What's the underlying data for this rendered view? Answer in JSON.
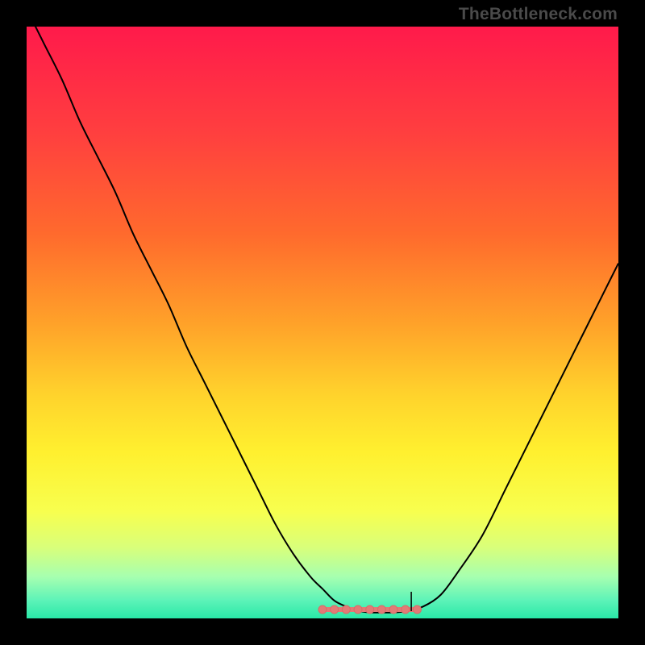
{
  "watermark": "TheBottleneck.com",
  "colors": {
    "frame": "#000000",
    "curve": "#000000",
    "marker_fill": "#e27a76",
    "marker_stroke": "#d86b67",
    "gradient_stops": [
      {
        "offset": 0.0,
        "color": "#ff1a4b"
      },
      {
        "offset": 0.18,
        "color": "#ff3f3f"
      },
      {
        "offset": 0.35,
        "color": "#ff6a2d"
      },
      {
        "offset": 0.5,
        "color": "#ffa129"
      },
      {
        "offset": 0.62,
        "color": "#ffd22c"
      },
      {
        "offset": 0.72,
        "color": "#fff02f"
      },
      {
        "offset": 0.82,
        "color": "#f7ff4f"
      },
      {
        "offset": 0.88,
        "color": "#d9ff7a"
      },
      {
        "offset": 0.93,
        "color": "#a6ffb0"
      },
      {
        "offset": 0.97,
        "color": "#5cf3b8"
      },
      {
        "offset": 1.0,
        "color": "#29e8a7"
      }
    ]
  },
  "chart_data": {
    "type": "line",
    "title": "",
    "xlabel": "",
    "ylabel": "",
    "xlim": [
      0,
      100
    ],
    "ylim": [
      0,
      100
    ],
    "x": [
      0,
      3,
      6,
      9,
      12,
      15,
      18,
      21,
      24,
      27,
      30,
      33,
      36,
      39,
      42,
      45,
      48,
      50,
      52,
      54,
      56,
      58,
      60,
      62,
      64,
      67,
      70,
      73,
      77,
      81,
      85,
      89,
      93,
      97,
      100
    ],
    "values": [
      103,
      97,
      91,
      84,
      78,
      72,
      65,
      59,
      53,
      46,
      40,
      34,
      28,
      22,
      16,
      11,
      7,
      5,
      3,
      2,
      1.3,
      1,
      1,
      1,
      1.2,
      2,
      4,
      8,
      14,
      22,
      30,
      38,
      46,
      54,
      60
    ],
    "flat_region": {
      "x_start": 50,
      "x_end": 66,
      "y": 1.5,
      "markers_x": [
        50,
        52,
        54,
        56,
        58,
        60,
        62,
        64,
        66
      ],
      "tick_x": 65,
      "tick_height": 3
    }
  }
}
